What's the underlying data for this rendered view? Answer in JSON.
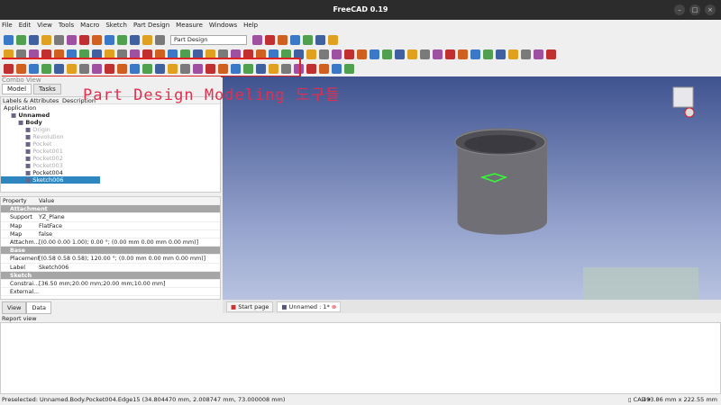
{
  "window": {
    "title": "FreeCAD 0.19"
  },
  "menu": [
    "File",
    "Edit",
    "View",
    "Tools",
    "Macro",
    "Sketch",
    "Part Design",
    "Measure",
    "Windows",
    "Help"
  ],
  "workbench": "Part Design",
  "overlay_text": "Part Design Modeling 도구들",
  "combo": {
    "title": "Combo View",
    "tabs": [
      "Model",
      "Tasks"
    ],
    "columns": [
      "Labels & Attributes",
      "Description"
    ],
    "tree": [
      {
        "label": "Application",
        "indent": 0,
        "state": "normal"
      },
      {
        "label": "Unnamed",
        "indent": 1,
        "state": "bold"
      },
      {
        "label": "Body",
        "indent": 2,
        "state": "bold"
      },
      {
        "label": "Origin",
        "indent": 3,
        "state": "grey"
      },
      {
        "label": "Revolution",
        "indent": 3,
        "state": "grey"
      },
      {
        "label": "Pocket",
        "indent": 3,
        "state": "grey"
      },
      {
        "label": "Pocket001",
        "indent": 3,
        "state": "grey"
      },
      {
        "label": "Pocket002",
        "indent": 3,
        "state": "grey"
      },
      {
        "label": "Pocket003",
        "indent": 3,
        "state": "grey"
      },
      {
        "label": "Pocket004",
        "indent": 3,
        "state": "normal"
      },
      {
        "label": "Sketch006",
        "indent": 3,
        "state": "selected"
      }
    ]
  },
  "properties": {
    "columns": [
      "Property",
      "Value"
    ],
    "rows": [
      {
        "section": "Attachment"
      },
      {
        "k": "Support",
        "v": "YZ_Plane"
      },
      {
        "k": "Map Mode",
        "v": "FlatFace"
      },
      {
        "k": "Map Rev...",
        "v": "false"
      },
      {
        "k": "Attachm...",
        "v": "[(0.00 0.00 1.00); 0.00 °; (0.00 mm  0.00 mm  0.00 mm)]"
      },
      {
        "section": "Base"
      },
      {
        "k": "Placement",
        "v": "[(0.58 0.58 0.58); 120.00 °; (0.00 mm  0.00 mm  0.00 mm)]"
      },
      {
        "k": "Label",
        "v": "Sketch006"
      },
      {
        "section": "Sketch"
      },
      {
        "k": "Constrai...",
        "v": "[36.50 mm;20.00 mm;20.00 mm;10.00 mm]"
      },
      {
        "k": "External...",
        "v": ""
      }
    ]
  },
  "bottom_tabs": [
    "View",
    "Data"
  ],
  "doc_tabs": [
    "Start page",
    "Unnamed : 1*"
  ],
  "report": {
    "title": "Report view"
  },
  "status": {
    "text": "Preselected: Unnamed.Body.Pocket004.Edge15 (34.804470 mm, 2.008747 mm, 73.000008 mm)",
    "nav": "CAD",
    "dims": "493.86 mm x 222.55 mm"
  }
}
